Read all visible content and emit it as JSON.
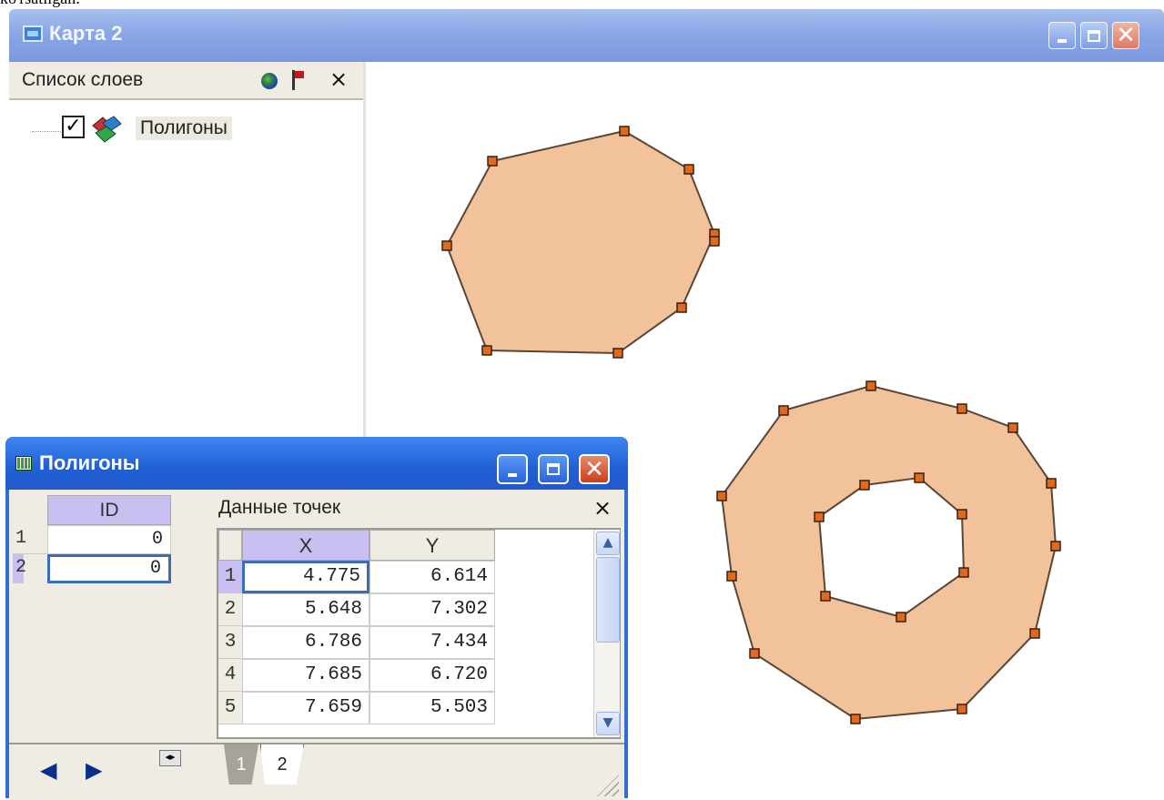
{
  "caption": "ko'rsatilgan.",
  "main_window": {
    "title": "Карта 2"
  },
  "layer_panel": {
    "title": "Список слоев",
    "icons": [
      "globe-icon",
      "flag-icon",
      "close-icon"
    ],
    "layers": [
      {
        "name": "Полигоны",
        "checked": true
      }
    ]
  },
  "table_window": {
    "title": "Полигоны",
    "id_grid": {
      "header": "ID",
      "rows": [
        {
          "num": "1",
          "id": "0"
        },
        {
          "num": "2",
          "id": "0"
        }
      ]
    },
    "points": {
      "title": "Данные точек",
      "headers": [
        "X",
        "Y"
      ],
      "rows": [
        {
          "num": "1",
          "x": "4.775",
          "y": "6.614"
        },
        {
          "num": "2",
          "x": "5.648",
          "y": "7.302"
        },
        {
          "num": "3",
          "x": "6.786",
          "y": "7.434"
        },
        {
          "num": "4",
          "x": "7.685",
          "y": "6.720"
        },
        {
          "num": "5",
          "x": "7.659",
          "y": "5.503"
        }
      ]
    },
    "tabs": [
      "1",
      "2"
    ],
    "active_tab": "2"
  },
  "colors": {
    "polygon_fill": "#f2c29a",
    "vertex": "#e06a1c",
    "title_blue": "#2359c9",
    "header_lavender": "#c9bff0"
  }
}
